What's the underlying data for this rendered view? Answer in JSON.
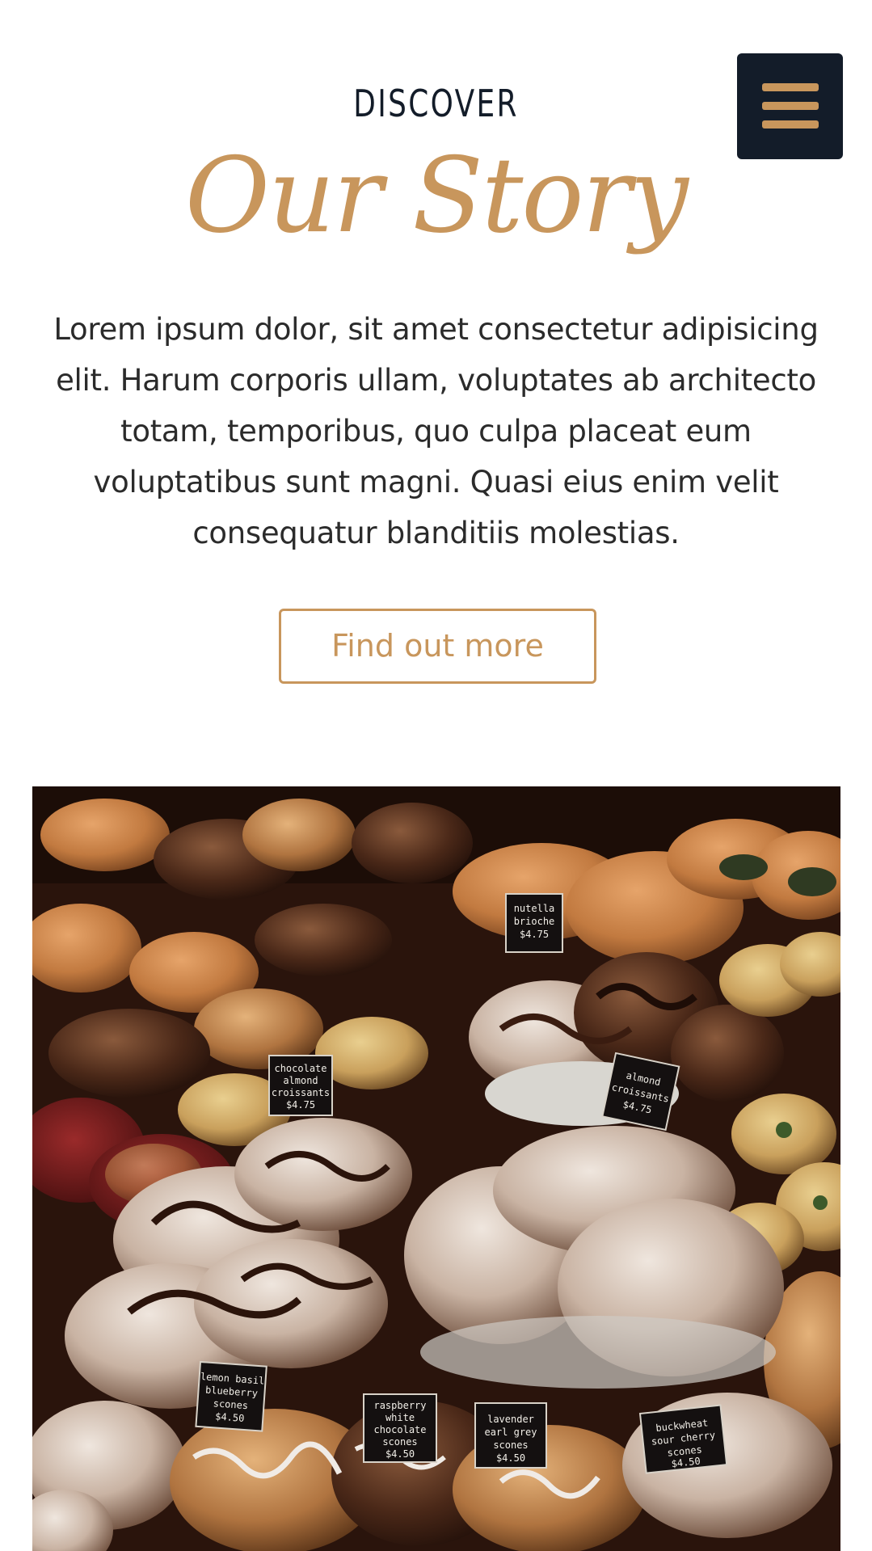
{
  "header": {
    "menu_icon": "hamburger-menu-icon",
    "eyebrow": "DISCOVER",
    "title": "Our Story"
  },
  "intro": {
    "text": "Lorem ipsum dolor, sit amet consectetur adipisicing elit. Harum corporis ullam, voluptates ab architecto totam, temporibus, quo culpa placeat eum voluptatibus sunt magni. Quasi eius enim velit consequatur blanditiis molestias."
  },
  "cta": {
    "label": "Find out more"
  },
  "photo": {
    "labels": {
      "chocolate_almond": [
        "chocolate",
        "almond",
        "croissants",
        "$4.75"
      ],
      "almond": [
        "almond",
        "croissants",
        "$4.75"
      ],
      "lemon_basil": [
        "lemon basil",
        "blueberry",
        "scones",
        "$4.50"
      ],
      "raspberry": [
        "raspberry",
        "white",
        "chocolate",
        "scones",
        "$4.50"
      ],
      "lavender": [
        "lavender",
        "earl grey",
        "scones",
        "$4.50"
      ],
      "buckwheat": [
        "buckwheat",
        "sour cherry",
        "scones",
        "$4.50"
      ],
      "nutella": [
        "nutella",
        "brioche",
        "$4.75"
      ]
    }
  },
  "colors": {
    "navy": "#131c29",
    "gold": "#c8965c",
    "body_text": "#2b2b2b"
  }
}
